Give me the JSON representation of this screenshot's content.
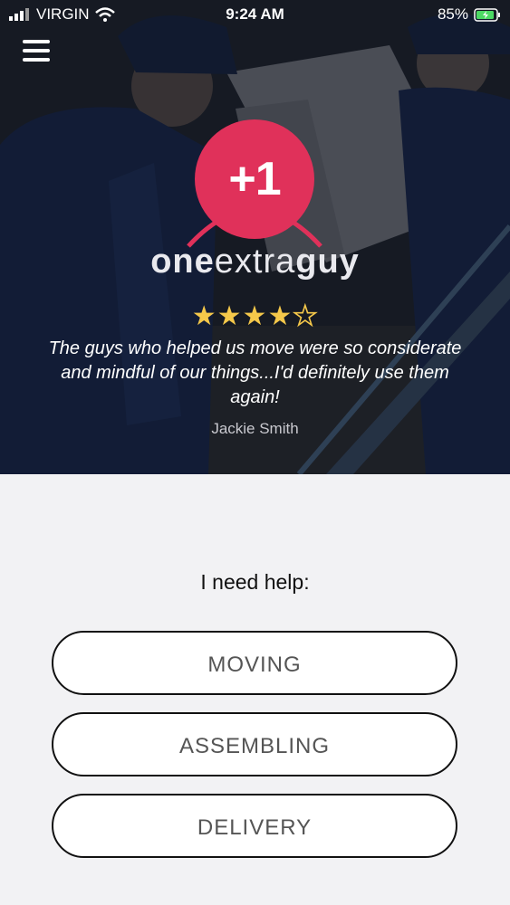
{
  "status": {
    "carrier": "VIRGIN",
    "time": "9:24 AM",
    "battery": "85%"
  },
  "logo": {
    "badge": "+1",
    "word_one": "one",
    "word_extra": "extra",
    "word_guy": "guy"
  },
  "testimonial": {
    "rating": 4,
    "max_rating": 5,
    "quote": "The guys who helped us move were so considerate and mindful of our things...I'd definitely use them again!",
    "author": "Jackie Smith"
  },
  "help": {
    "heading": "I need help:",
    "options": [
      "MOVING",
      "ASSEMBLING",
      "DELIVERY"
    ]
  },
  "colors": {
    "brand": "#e0315a",
    "star": "#f5c84a"
  },
  "icons": [
    "signal-icon",
    "wifi-icon",
    "battery-icon",
    "hamburger-menu-icon",
    "star-icon"
  ]
}
